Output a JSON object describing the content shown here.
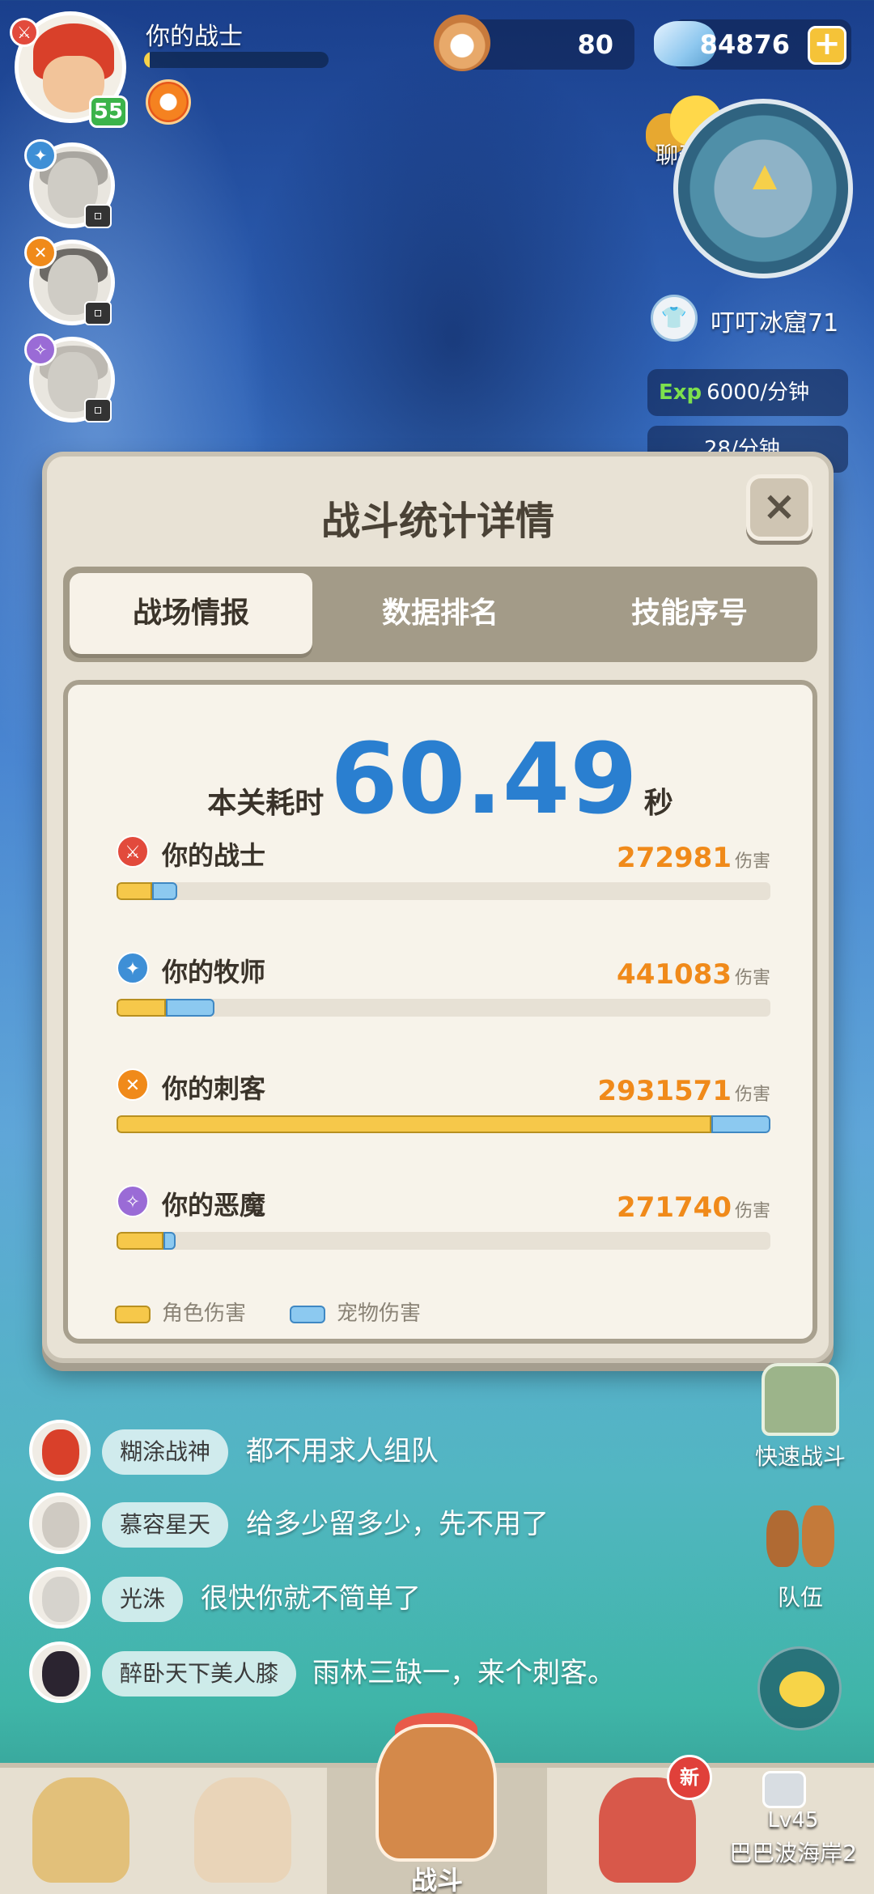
{
  "hud": {
    "player_name": "你的战士",
    "level": "55",
    "xp_progress": 0.03,
    "pearls": "80",
    "crystals": "84876",
    "chat_label": "聊天",
    "location": "叮叮冰窟71",
    "exp_tag": "Exp",
    "exp_rate": "6000/分钟",
    "crystal_rate": "28/分钟"
  },
  "modal": {
    "title": "战斗统计详情",
    "close": "×",
    "tabs": [
      {
        "label": "战场情报",
        "active": true
      },
      {
        "label": "数据排名",
        "active": false
      },
      {
        "label": "技能序号",
        "active": false
      }
    ],
    "time_label": "本关耗时",
    "time_value": "60.49",
    "time_unit": "秒",
    "damage_unit": "伤害",
    "legend": {
      "role": "角色伤害",
      "pet": "宠物伤害"
    },
    "colors": {
      "role": "#f6c84a",
      "pet": "#8cc9f0",
      "damage_text": "#f08a1a",
      "time": "#2a7fd0"
    }
  },
  "chart_data": {
    "type": "bar",
    "orientation": "horizontal",
    "stacked": true,
    "max_reference": 2931571,
    "categories": [
      "你的战士",
      "你的牧师",
      "你的刺客",
      "你的恶魔"
    ],
    "totals": [
      272981,
      441083,
      2931571,
      271740
    ],
    "series": [
      {
        "name": "角色伤害",
        "fraction_of_max": [
          0.055,
          0.075,
          0.91,
          0.072
        ]
      },
      {
        "name": "宠物伤害",
        "fraction_of_max": [
          0.038,
          0.075,
          0.09,
          0.018
        ]
      }
    ],
    "class_colors": [
      "#e24a3c",
      "#3e8fd6",
      "#f08a1a",
      "#9a6bd6"
    ],
    "class_glyphs": [
      "⚔",
      "✦",
      "✕",
      "✧"
    ]
  },
  "chat": [
    {
      "name": "糊涂战神",
      "text": "都不用求人组队",
      "avatar_color": "#d9402a"
    },
    {
      "name": "慕容星天",
      "text": "给多少留多少，先不用了",
      "avatar_color": "#cfcac2"
    },
    {
      "name": "光洙",
      "text": "很快你就不简单了",
      "avatar_color": "#d6d3cd"
    },
    {
      "name": "醉卧天下美人膝",
      "text": "雨林三缺一，来个刺客。",
      "avatar_color": "#2b2430"
    }
  ],
  "side": {
    "quick_battle": "快速战斗",
    "team": "队伍"
  },
  "nav": {
    "battle": "战斗",
    "new_badge": "新",
    "locked_level": "Lv45",
    "locked_area": "巴巴波海岸2"
  }
}
